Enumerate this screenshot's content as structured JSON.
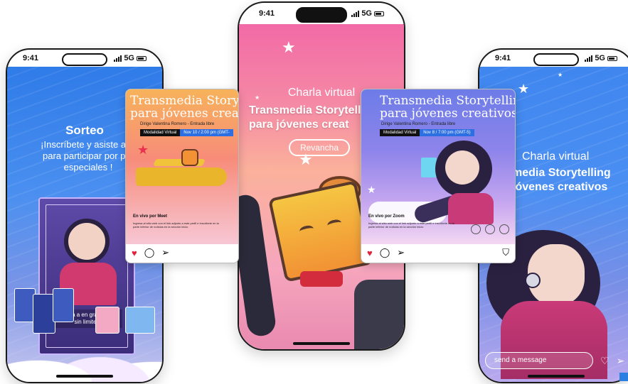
{
  "status": {
    "time": "9:41",
    "network": "5G"
  },
  "left_story": {
    "title": "Sorteo",
    "body": "¡Inscríbete y asiste al e\npara participar por pre\nespeciales !",
    "poster_tagline": "Soa a en grande.\nsin limites"
  },
  "left_post": {
    "title_line1": "Transmedia Story",
    "title_line2": "para jóvenes creat",
    "host": "Dirige Valentina Romero - Entrada libre",
    "mode_label": "Modalidad Virtual",
    "date": "Nov 10 / 2:00 pm (GMT-",
    "live_label": "En vivo por Meet",
    "live_desc": "Ingresa al sitio web con el link adjunto a este perfil e inscríbete en la parte inferior de noticias en la sección inicio"
  },
  "center_story": {
    "subtitle": "Charla virtual",
    "heading": "Transmedia Storytelling\npara jóvenes creat",
    "button": "Revancha"
  },
  "right_post": {
    "title_line1": "Transmedia Storytelling",
    "title_line2": "para jóvenes creativos",
    "host": "Dirige Valentina Romero - Entrada libre",
    "mode_label": "Modalidad Virtual",
    "date": "Nov 8 / 7:00 pm (GMT-5)",
    "live_label": "En vivo por Zoom",
    "live_desc": "Ingresa al sitio web con el link adjunto a este perfil e inscríbete en la parte inferior de noticias en la sección inicio"
  },
  "right_story": {
    "subtitle": "Charla virtual",
    "heading": "media Storytelling\njóvenes creativos",
    "message_placeholder": "send a message"
  },
  "icons": {
    "heart": "♥",
    "comment": "◯",
    "share": "➢",
    "bookmark": "⛉",
    "star": "★"
  },
  "colors": {
    "story_blue": "#2f7be8",
    "story_pink": "#f26aa6",
    "heart_red": "#e3223c",
    "pill_blue": "#2b6fe3"
  }
}
